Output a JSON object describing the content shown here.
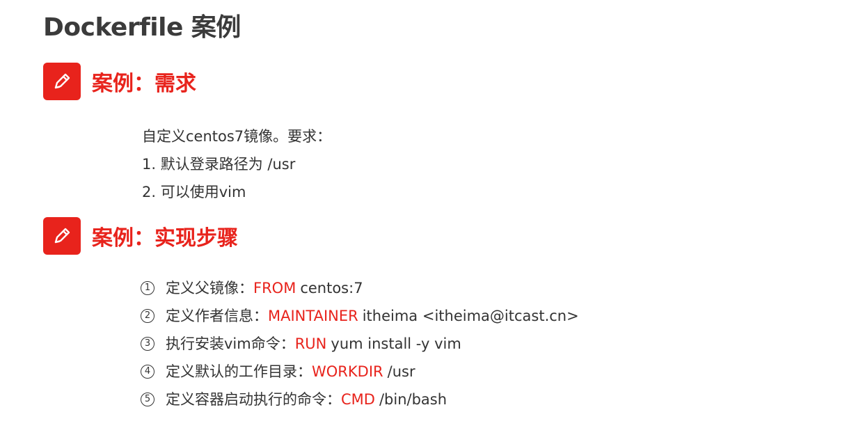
{
  "title": "Dockerfile 案例",
  "sections": [
    {
      "icon": "pencil-icon",
      "label": "案例：需求"
    },
    {
      "icon": "pencil-icon",
      "label": "案例：实现步骤"
    }
  ],
  "requirements": {
    "intro": "自定义centos7镜像。要求：",
    "items": [
      "1. 默认登录路径为 /usr",
      "2. 可以使用vim"
    ]
  },
  "steps": [
    {
      "num": "1",
      "desc": "定义父镜像：",
      "keyword": "FROM",
      "value": "centos:7"
    },
    {
      "num": "2",
      "desc": "定义作者信息：",
      "keyword": "MAINTAINER",
      "value": "itheima <itheima@itcast.cn>"
    },
    {
      "num": "3",
      "desc": "执行安装vim命令：",
      "keyword": "RUN",
      "value": "yum install -y vim"
    },
    {
      "num": "4",
      "desc": "定义默认的工作目录：",
      "keyword": "WORKDIR",
      "value": "/usr"
    },
    {
      "num": "5",
      "desc": "定义容器启动执行的命令：",
      "keyword": "CMD",
      "value": "/bin/bash"
    }
  ],
  "colors": {
    "accent": "#e8231c",
    "text": "#333333",
    "title": "#3b3b3b"
  }
}
